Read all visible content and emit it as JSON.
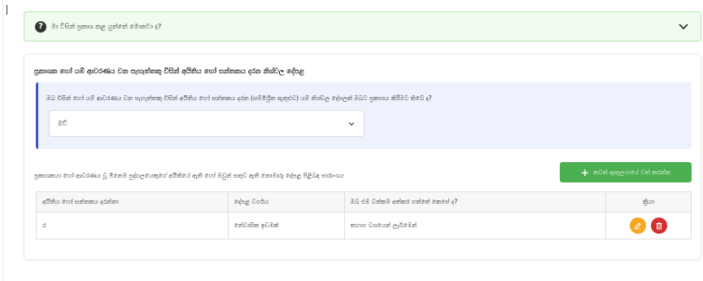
{
  "faq": {
    "question": "මා විසින් ප්‍රකාශ කළ යුත්තේ මොනවා ද?",
    "icon": "question-circle-icon",
    "toggle_icon": "chevron-down-icon"
  },
  "section": {
    "title": "ප්‍රකාශක හෝ යම් ආවරණය වන පැහැත්තකු විසින් අයිතිය හෝ සන්තකය දරන නිශ්චල දේපළ",
    "question": "ඔබ විසින් හෝ යම් ආවරණය වන පැහැත්තකු විසින් අයිතිය හෝ සන්තකය දරන (සම්මිශ්‍රිත ඇතුළුව) යම් නිශ්චල දේපලක් ඔබට ප්‍රකාශය කිරීමට තිබේ ද?",
    "select_value": "ඔව්"
  },
  "summary": {
    "title": "ප්‍රකාශකයා හෝ ආවරණය වූ මිනෙම පුද්ගලයෙකුගේ අයිතියේ ඇති හෝ ඔවුන් සතුව ඇති නොමාරු දේපළ පිළිබඳ සාරාංශය",
    "add_button": "නවත් ඇතුලංගයේ වත් කරන්න"
  },
  "table": {
    "headers": [
      "අයිතිය හෝ සන්තකය දරන්නා",
      "දේපළ වර්ගය",
      "ඔබ එම වත්කම අත්කර ගත්තේ කෙසේ ද?",
      "ක්‍රියා"
    ],
    "rows": [
      {
        "holder": "ර",
        "type": "නේවාසික ඉඩමක්",
        "acquired": "තහාග වශයෙන් ලැබීමෙන්"
      }
    ]
  },
  "colors": {
    "accent_green": "#4caf50",
    "accent_blue": "#3b55c9",
    "edit": "#f5a623",
    "delete": "#d32f2f"
  }
}
